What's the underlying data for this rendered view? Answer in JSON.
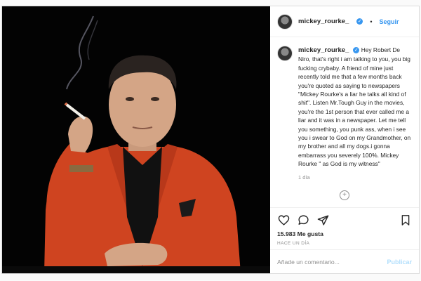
{
  "post": {
    "username": "mickey_rourke_",
    "follow_label": "Seguir",
    "separator": "•",
    "caption": "Hey Robert De Niro, that's right i am talking to you, you big fucking crybaby. A friend of mine just recently told me that a few months back you're quoted as saying to newspapers \"Mickey Rourke's a liar he talks all kind of shit\". Listen Mr.Tough Guy in the movies, you're the 1st person that ever called me a liar and it was in a newspaper. Let me tell you something, you punk ass, when i see you i swear to God on my Grandmother, on my brother and all my dogs.i gonna embarrass you severely 100%. Mickey Rourke \" as God is my witness\"",
    "caption_time": "1 día",
    "likes": "15.983 Me gusta",
    "posted_ago": "HACE UN DÍA",
    "comment_placeholder": "Añade un comentario...",
    "publish_label": "Publicar"
  },
  "icons": {
    "like": "heart-icon",
    "comment": "comment-icon",
    "share": "share-icon",
    "save": "bookmark-icon",
    "verified": "verified-badge-icon",
    "load_more": "plus-circle-icon"
  },
  "colors": {
    "link_blue": "#3897f0",
    "publish_disabled": "#b2dffc",
    "jacket": "#d9481f",
    "background": "#000000"
  }
}
